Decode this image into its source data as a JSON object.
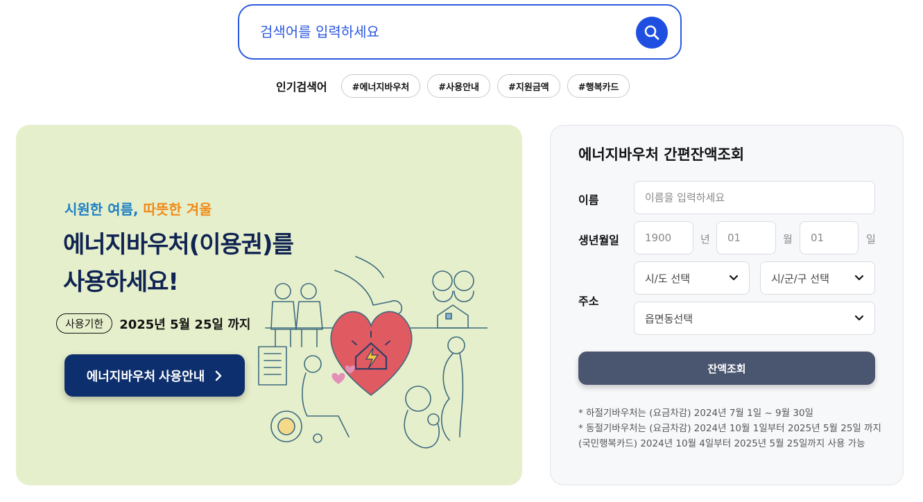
{
  "search": {
    "placeholder": "검색어를 입력하세요",
    "button_icon": "search-icon"
  },
  "popular": {
    "label": "인기검색어",
    "tags": [
      "#에너지바우처",
      "#사용안내",
      "#지원금액",
      "#행복카드"
    ]
  },
  "banner": {
    "subtitle_part1": "시원한 여름,",
    "subtitle_part2": "따뜻한 겨울",
    "title_line1": "에너지바우처(이용권)를",
    "title_line2": "사용하세요!",
    "period_badge": "사용기한",
    "period_text": "2025년 5월 25일 까지",
    "guide_button": "에너지바우처 사용안내",
    "colors": {
      "background": "#e6efcb",
      "title": "#0e2352",
      "subtitle_blue": "#1b7fc4",
      "subtitle_orange": "#f08a1a",
      "button": "#0d2f6e",
      "heart": "#e05a62"
    }
  },
  "balance": {
    "title": "에너지바우처 간편잔액조회",
    "name_label": "이름",
    "name_placeholder": "이름을 입력하세요",
    "birth_label": "생년월일",
    "birth_year": "1900",
    "birth_year_unit": "년",
    "birth_month": "01",
    "birth_month_unit": "월",
    "birth_day": "01",
    "birth_day_unit": "일",
    "address_label": "주소",
    "sido_select": "시/도 선택",
    "sigungu_select": "시/군/구 선택",
    "eupmyeondong_select": "읍면동선택",
    "submit_button": "잔액조회",
    "note1": "* 하절기바우처는 (요금차감) 2024년 7월 1일 ~ 9월 30일",
    "note2": "* 동절기바우처는 (요금차감) 2024년 10월 1일부터 2025년 5월 25일 까지 (국민행복카드) 2024년 10월 4일부터 2025년 5월 25일까지 사용 가능"
  }
}
